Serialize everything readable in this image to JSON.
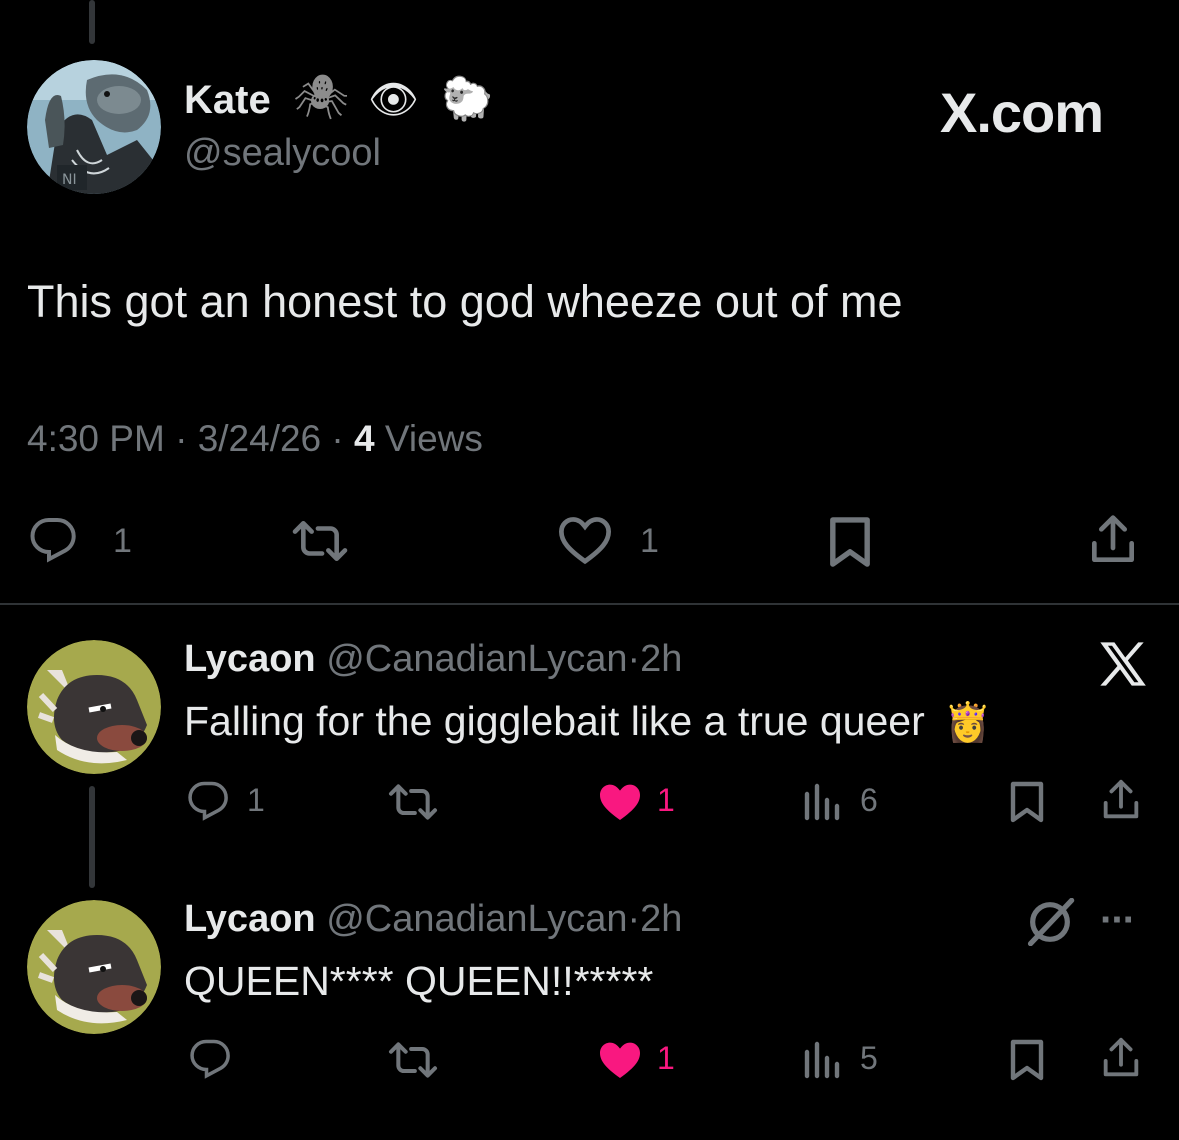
{
  "main_tweet": {
    "author_name": "Kate",
    "name_emojis": [
      "🕷",
      "👁",
      "🐑"
    ],
    "handle": "@sealycool",
    "site_watermark": "X.com",
    "text": "This got an honest to god wheeze out of me",
    "time": "4:30 PM",
    "date": "3/24/26",
    "sep": "·",
    "views_count": "4",
    "views_label": "Views",
    "reply_count": "1",
    "like_count": "1"
  },
  "replies": [
    {
      "author_name": "Lycaon",
      "handle": "@CanadianLycan",
      "sep": "·",
      "time": "2h",
      "text": "Falling for the gigglebait like a true queer",
      "text_emoji": "👸",
      "reply_count": "1",
      "like_count": "1",
      "view_count": "6",
      "top_right_icon": "x-logo-icon"
    },
    {
      "author_name": "Lycaon",
      "handle": "@CanadianLycan",
      "sep": "·",
      "time": "2h",
      "text": "QUEEN**** QUEEN!!*****",
      "reply_count": "",
      "like_count": "1",
      "view_count": "5",
      "top_right_icon": "slash-circle-icon",
      "more": "···"
    }
  ],
  "colors": {
    "background": "#000000",
    "text": "#e7e9ea",
    "secondary": "#71767b",
    "like_active": "#f91880",
    "divider": "#2f3336"
  }
}
